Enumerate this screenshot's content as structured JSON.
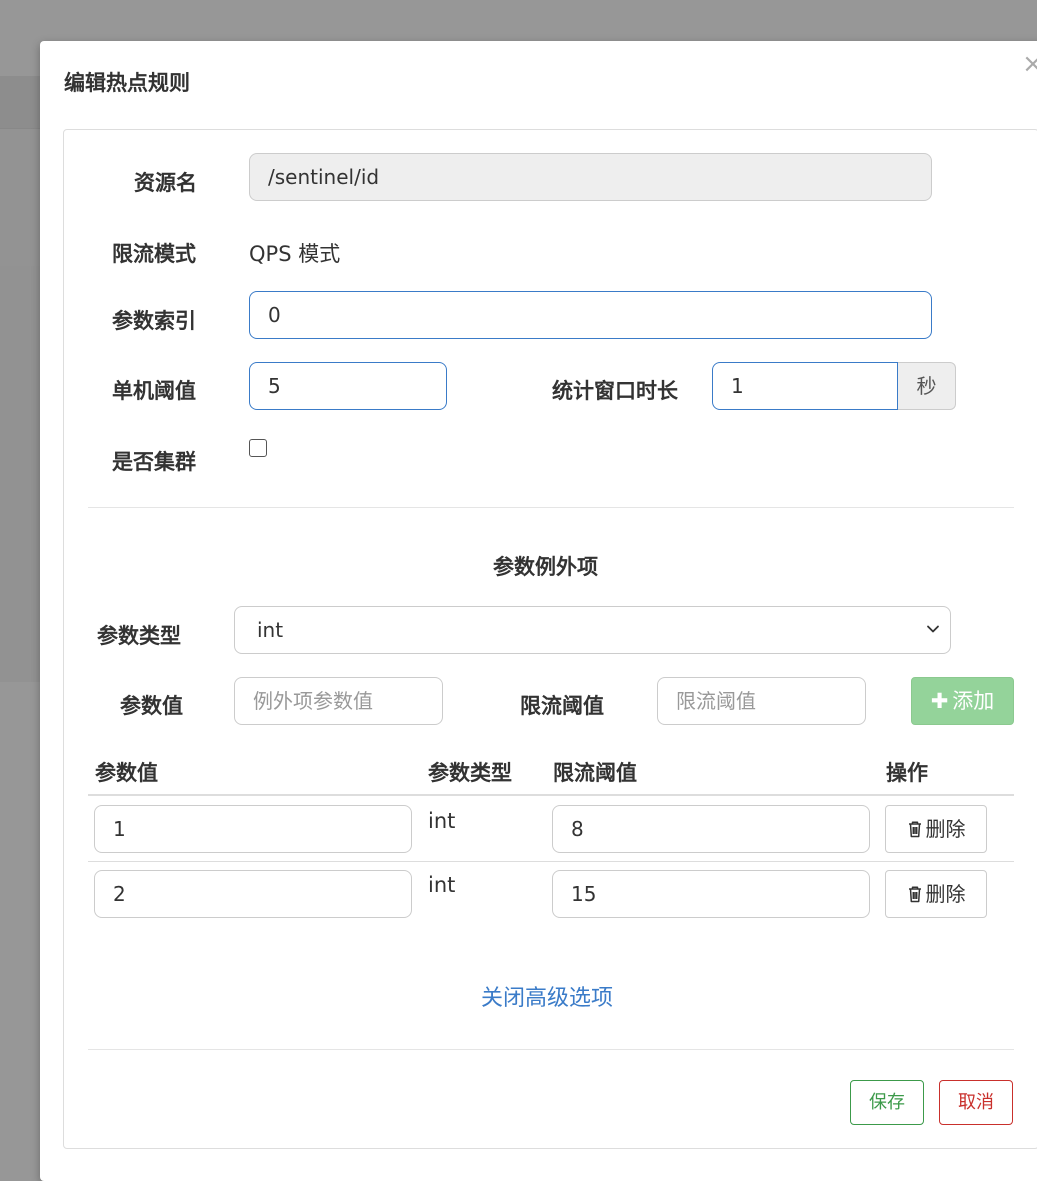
{
  "modal": {
    "title": "编辑热点规则",
    "close": "×"
  },
  "form": {
    "resource_label": "资源名",
    "resource_value": "/sentinel/id",
    "mode_label": "限流模式",
    "mode_value": "QPS 模式",
    "param_index_label": "参数索引",
    "param_index_value": "0",
    "threshold_label": "单机阈值",
    "threshold_value": "5",
    "window_label": "统计窗口时长",
    "window_value": "1",
    "window_unit": "秒",
    "cluster_label": "是否集群",
    "cluster_checked": false
  },
  "exceptions": {
    "title": "参数例外项",
    "param_type_label": "参数类型",
    "param_type_value": "int",
    "param_value_label": "参数值",
    "param_value_placeholder": "例外项参数值",
    "limit_label": "限流阈值",
    "limit_placeholder": "限流阈值",
    "add_label": "添加",
    "table": {
      "headers": [
        "参数值",
        "参数类型",
        "限流阈值",
        "操作"
      ],
      "rows": [
        {
          "value": "1",
          "type": "int",
          "limit": "8",
          "action": "删除"
        },
        {
          "value": "2",
          "type": "int",
          "limit": "15",
          "action": "删除"
        }
      ]
    },
    "toggle_link": "关闭高级选项"
  },
  "footer": {
    "save": "保存",
    "cancel": "取消"
  },
  "colors": {
    "link": "#3a7bc8",
    "save": "#3c9a4a",
    "cancel": "#c9302c",
    "add": "#94d39a"
  }
}
